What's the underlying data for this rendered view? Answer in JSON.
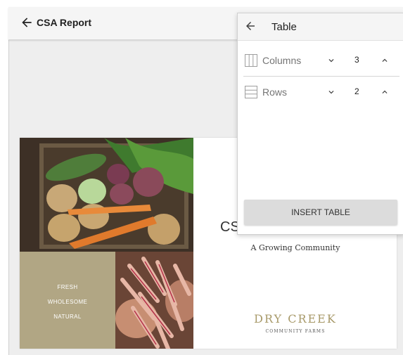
{
  "header": {
    "title": "CSA Report"
  },
  "document": {
    "title": "CSA",
    "subtitle": "A Growing Community",
    "tagline": [
      "FRESH",
      "WHOLESOME",
      "NATURAL"
    ],
    "brand_name": "DRY CREEK",
    "brand_sub": "COMMUNITY FARMS"
  },
  "panel": {
    "title": "Table",
    "columns": {
      "label": "Columns",
      "value": "3"
    },
    "rows": {
      "label": "Rows",
      "value": "2"
    },
    "insert_label": "INSERT TABLE"
  },
  "colors": {
    "accent_tan": "#b1a684",
    "brand_gold": "#a89a6a"
  },
  "icons": [
    "back-arrow",
    "columns-icon",
    "rows-icon",
    "chevron-down",
    "chevron-up"
  ]
}
